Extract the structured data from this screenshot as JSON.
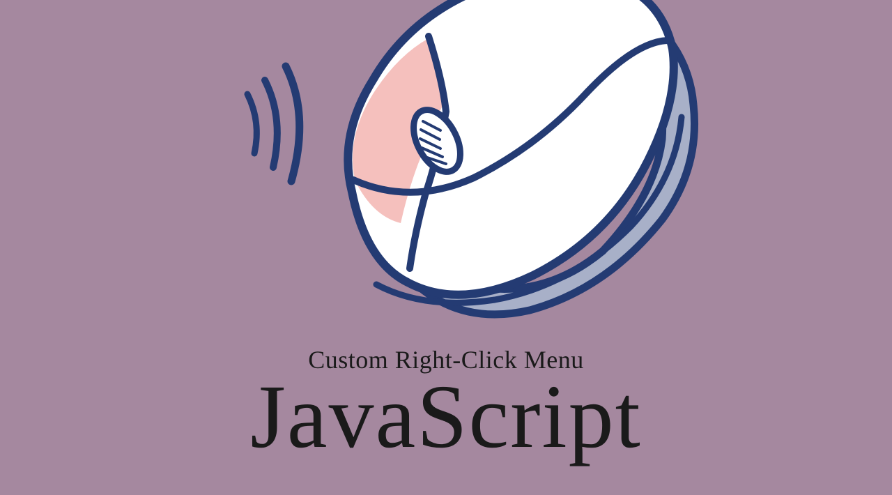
{
  "text": {
    "subtitle": "Custom Right-Click Menu",
    "title": "JavaScript"
  },
  "colors": {
    "background": "#a5889f",
    "outline": "#243b73",
    "mouse_body": "#ffffff",
    "mouse_button": "#f5c0bd",
    "mouse_shadow": "#a8b0c8",
    "text": "#1a1a1a"
  },
  "illustration": {
    "description": "computer-mouse-illustration",
    "motion_lines": 3
  }
}
